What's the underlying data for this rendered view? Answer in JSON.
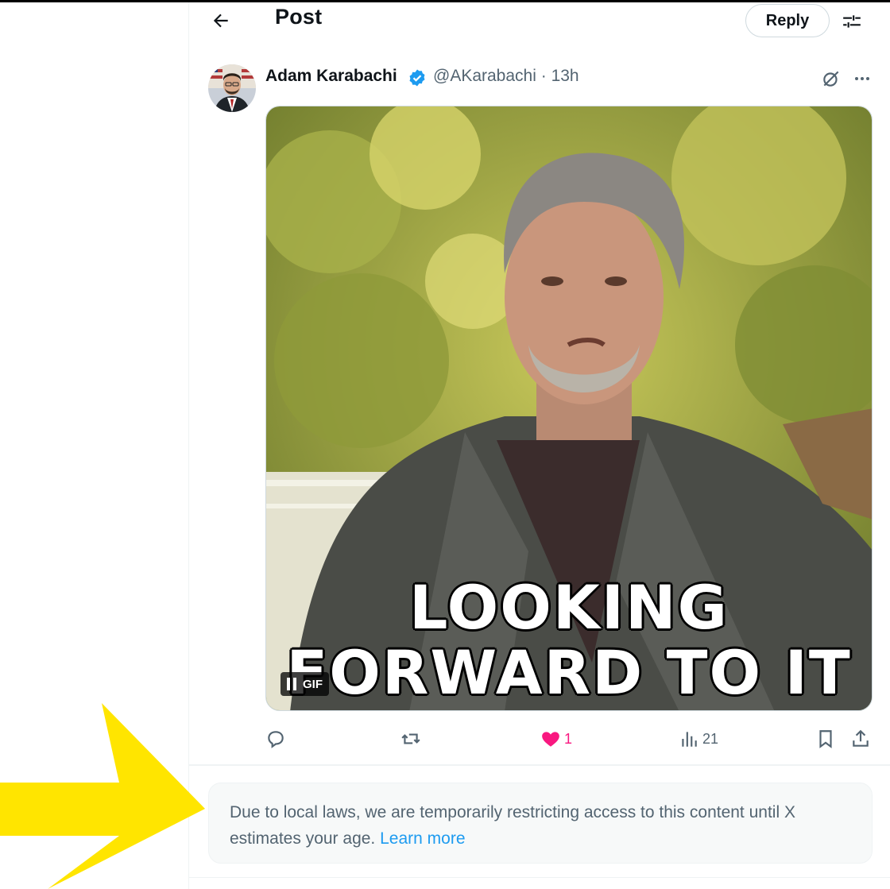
{
  "header": {
    "title": "Post",
    "reply_label": "Reply"
  },
  "post": {
    "author_name": "Adam Karabachi",
    "handle": "@AKarabachi",
    "separator": "·",
    "age": "13h",
    "verified": true,
    "media": {
      "caption_line1": "LOOKING",
      "caption_line2": "FORWARD TO IT",
      "badge": "GIF"
    },
    "stats": {
      "likes": "1",
      "views": "21"
    }
  },
  "notice": {
    "text": "Due to local laws, we are temporarily restricting access to this content until X estimates your age.",
    "link_label": "Learn more"
  },
  "colors": {
    "accent": "#1d9bf0",
    "like": "#f91880",
    "annotation_arrow": "#ffe500"
  },
  "icons": [
    "back-arrow-icon",
    "filter-icon",
    "verified-badge-icon",
    "grok-icon",
    "more-icon",
    "reply-icon",
    "repost-icon",
    "heart-icon",
    "views-icon",
    "bookmark-icon",
    "share-icon",
    "pause-icon"
  ]
}
